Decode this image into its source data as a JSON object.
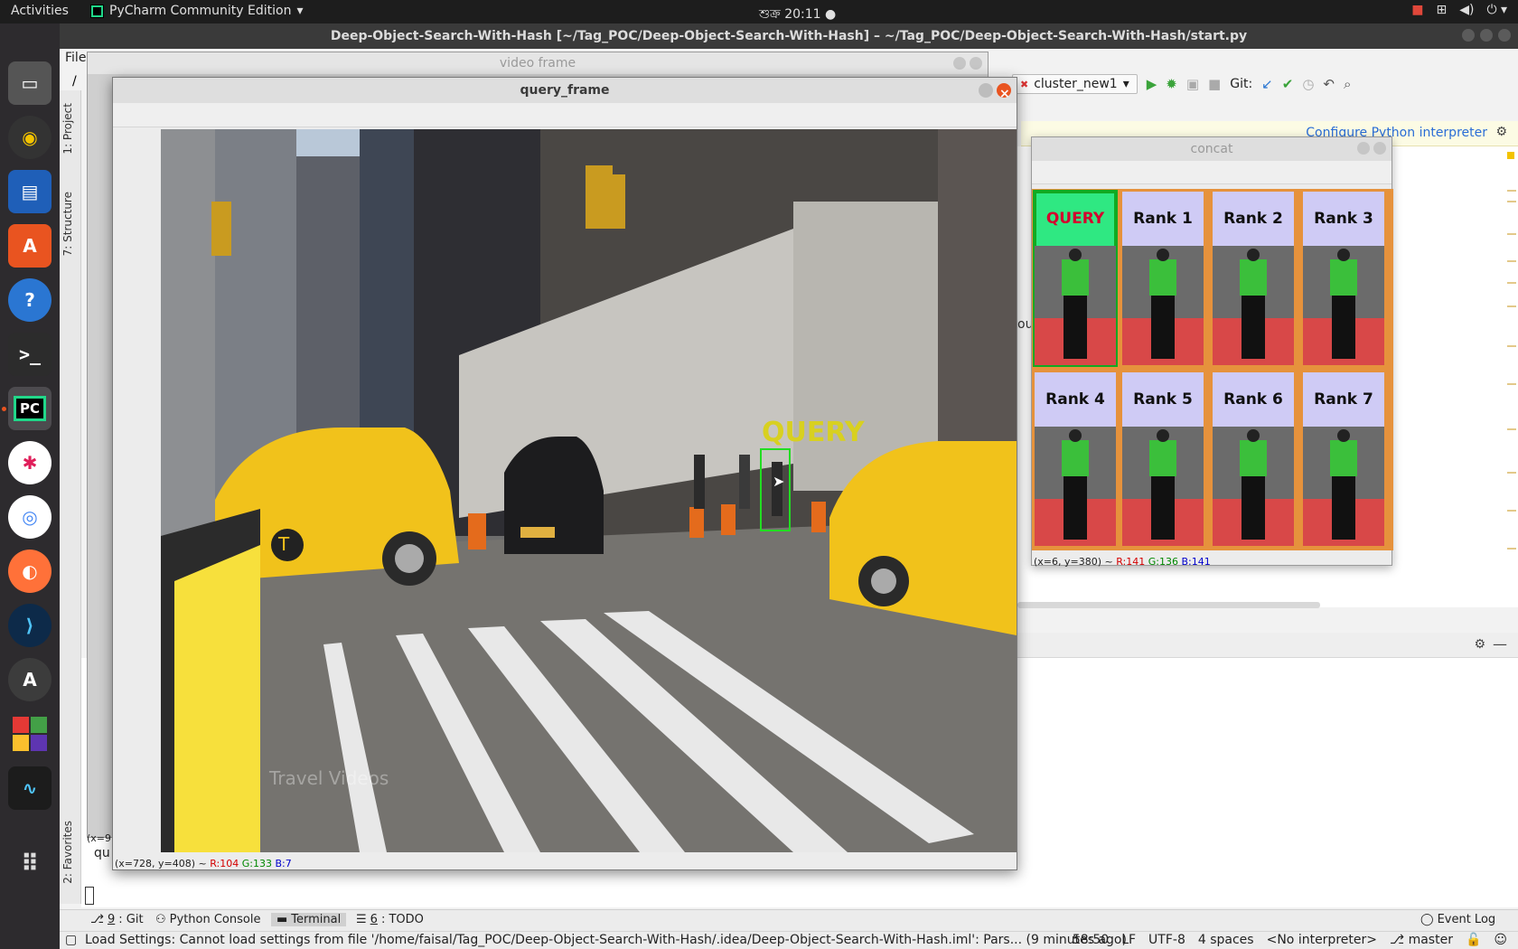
{
  "topbar": {
    "activities": "Activities",
    "app_name": "PyCharm Community Edition",
    "clock": "শুক্র 20:11 ●"
  },
  "pycharm": {
    "window_title": "Deep-Object-Search-With-Hash [~/Tag_POC/Deep-Object-Search-With-Hash] – ~/Tag_POC/Deep-Object-Search-With-Hash/start.py",
    "menu_file": "File",
    "breadcrumb_root": "/",
    "left_tabs": {
      "project": "1: Project",
      "structure": "7: Structure",
      "favorites": "2: Favorites"
    },
    "run_config": "cluster_new1",
    "git_label": "Git:",
    "notify_link": "Configure Python interpreter",
    "partial_text": "ou",
    "bottom_tabs": [
      {
        "num": "9",
        "label": ": Git"
      },
      {
        "num": "",
        "label": "Python Console"
      },
      {
        "num": "",
        "label": "Terminal"
      },
      {
        "num": "6",
        "label": ": TODO"
      }
    ],
    "event_log": "Event Log",
    "status_message": "Load Settings: Cannot load settings from file '/home/faisal/Tag_POC/Deep-Object-Search-With-Hash/.idea/Deep-Object-Search-With-Hash.iml': Pars... (9 minutes ago)",
    "status_right": {
      "position": "58:50",
      "line_sep": "LF",
      "encoding": "UTF-8",
      "indent": "4 spaces",
      "interpreter": "<No interpreter>",
      "branch": "master"
    }
  },
  "video_frame": {
    "title": "video frame",
    "readout_partial": "(x=9",
    "text_partial": "qu"
  },
  "query_frame": {
    "title": "query_frame",
    "overlay_label": "QUERY",
    "watermark": "Travel Videos",
    "readout_pos": "(x=728, y=408) ~",
    "readout_r": "R:104",
    "readout_g": "G:133",
    "readout_b": "B:7"
  },
  "concat": {
    "title": "concat",
    "tiles": [
      "QUERY",
      "Rank 1",
      "Rank 2",
      "Rank 3",
      "Rank 4",
      "Rank 5",
      "Rank 6",
      "Rank 7"
    ],
    "readout_pos": "(x=6, y=380) ~",
    "readout_r": "R:141",
    "readout_g": "G:136",
    "readout_b": "B:141"
  },
  "colors": {
    "ubuntu_orange": "#e95420",
    "query_box": "#22dd22",
    "query_label": "#d8d020",
    "tile_border": "#e6923c",
    "query_tile_bg": "#2fe882"
  }
}
